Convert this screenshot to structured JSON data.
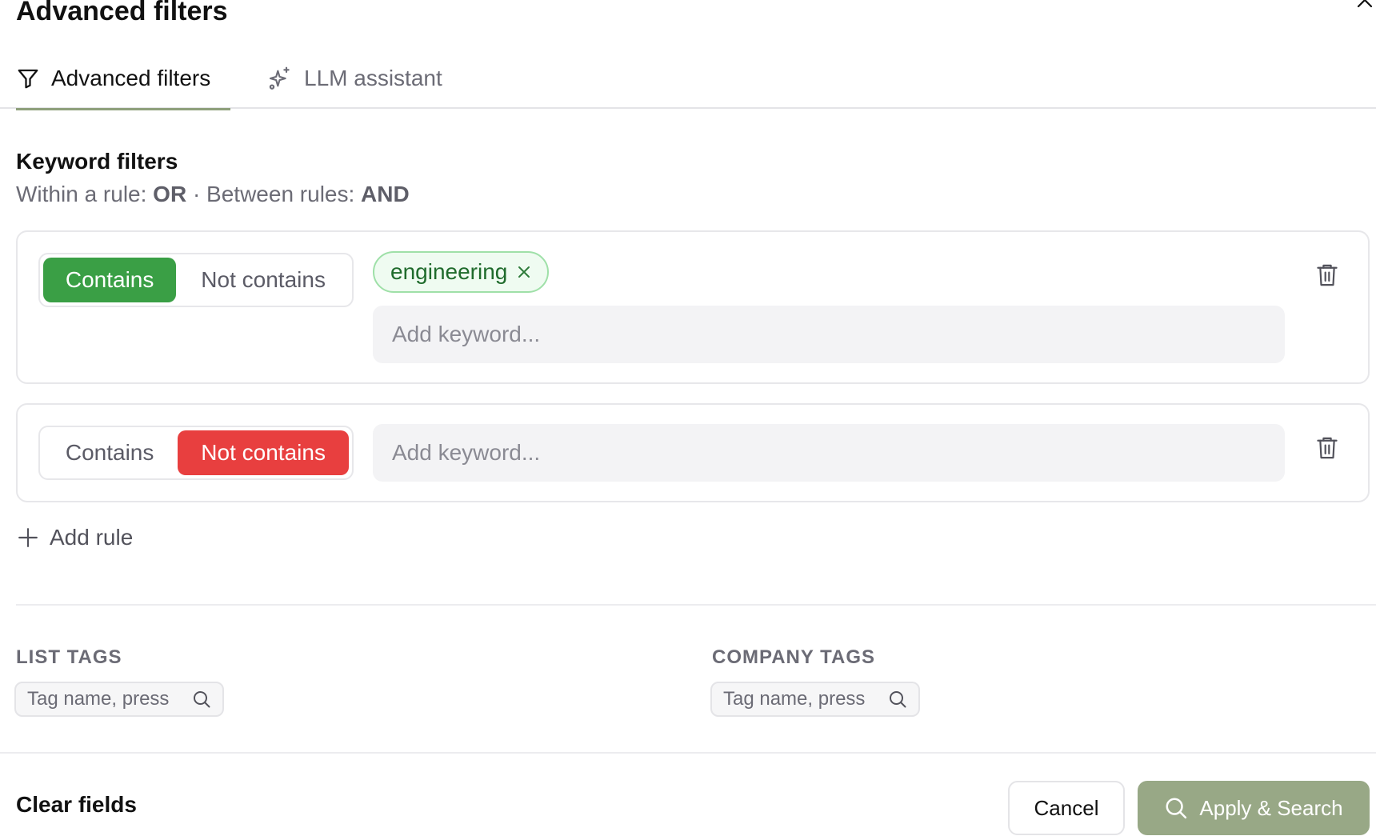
{
  "modal": {
    "title": "Advanced filters",
    "close_icon": "close-icon"
  },
  "tabs": [
    {
      "label": "Advanced filters",
      "icon": "filter-icon",
      "active": true
    },
    {
      "label": "LLM assistant",
      "icon": "sparkles-icon",
      "active": false
    }
  ],
  "keyword_filters": {
    "title": "Keyword filters",
    "subtitle_prefix": "Within a rule: ",
    "within_value": "OR",
    "subtitle_middle": " · Between rules: ",
    "between_value": "AND",
    "rules": [
      {
        "mode_options": [
          "Contains",
          "Not contains"
        ],
        "selected_mode": "Contains",
        "keywords": [
          "engineering"
        ],
        "input_placeholder": "Add keyword..."
      },
      {
        "mode_options": [
          "Contains",
          "Not contains"
        ],
        "selected_mode": "Not contains",
        "keywords": [],
        "input_placeholder": "Add keyword..."
      }
    ],
    "add_rule_label": "Add rule"
  },
  "tags": {
    "list_label": "LIST TAGS",
    "list_placeholder": "Tag name, press",
    "company_label": "COMPANY TAGS",
    "company_placeholder": "Tag name, press"
  },
  "footer": {
    "clear_label": "Clear fields",
    "cancel_label": "Cancel",
    "apply_label": "Apply & Search"
  },
  "colors": {
    "accent": "#8e9f7b",
    "apply_bg": "#98a886",
    "contains_active": "#3a9f45",
    "not_contains_active": "#e83f3f",
    "chip_bg": "#effbf1",
    "chip_border": "#9fe0a8"
  }
}
